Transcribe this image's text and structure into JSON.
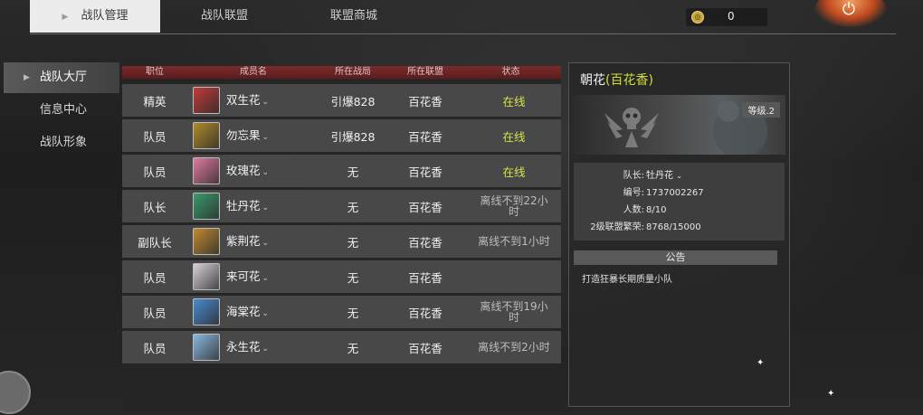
{
  "tabs": [
    {
      "label": "战队管理",
      "active": true
    },
    {
      "label": "战队联盟",
      "active": false
    },
    {
      "label": "联盟商城",
      "active": false
    }
  ],
  "currency": {
    "value": "0",
    "icon": "coin-icon"
  },
  "sidebar": {
    "items": [
      {
        "label": "战队大厅",
        "active": true
      },
      {
        "label": "信息中心",
        "active": false
      },
      {
        "label": "战队形象",
        "active": false
      }
    ]
  },
  "table": {
    "headers": [
      "职位",
      "成员名",
      "所在战局",
      "所在联盟",
      "状态"
    ],
    "rows": [
      {
        "position": "精英",
        "name": "双生花",
        "game": "引爆828",
        "alliance": "百花香",
        "status": "在线",
        "online": true,
        "avatar_color": "#c23a3a"
      },
      {
        "position": "队员",
        "name": "勿忘果",
        "game": "引爆828",
        "alliance": "百花香",
        "status": "在线",
        "online": true,
        "avatar_color": "#b08a2a"
      },
      {
        "position": "队员",
        "name": "玫瑰花",
        "game": "无",
        "alliance": "百花香",
        "status": "在线",
        "online": true,
        "avatar_color": "#e07aa0"
      },
      {
        "position": "队长",
        "name": "牡丹花",
        "game": "无",
        "alliance": "百花香",
        "status": "离线不到22小时",
        "online": false,
        "avatar_color": "#3a9a6a"
      },
      {
        "position": "副队长",
        "name": "紫荆花",
        "game": "无",
        "alliance": "百花香",
        "status": "离线不到1小时",
        "online": false,
        "avatar_color": "#c08a30"
      },
      {
        "position": "队员",
        "name": "来可花",
        "game": "无",
        "alliance": "百花香",
        "status": "",
        "online": false,
        "avatar_color": "#d8d0d8"
      },
      {
        "position": "队员",
        "name": "海棠花",
        "game": "无",
        "alliance": "百花香",
        "status": "离线不到19小时",
        "online": false,
        "avatar_color": "#4a8ad0"
      },
      {
        "position": "队员",
        "name": "永生花",
        "game": "无",
        "alliance": "百花香",
        "status": "离线不到2小时",
        "online": false,
        "avatar_color": "#8ab8e0"
      }
    ]
  },
  "team": {
    "name": "朝花",
    "alliance_tag": "(百花香)",
    "level": "等级.2",
    "info": [
      {
        "label": "队长:",
        "value": "牡丹花"
      },
      {
        "label": "编号:",
        "value": "1737002267"
      },
      {
        "label": "人数:",
        "value": "8/10"
      },
      {
        "label": "2级联盟繁荣:",
        "value": "8768/15000"
      }
    ],
    "notice_title": "公告",
    "notice_text": "打造狂暴长期质量小队"
  },
  "colors": {
    "accent_online": "#d8e24a",
    "header_red": "#6a2222",
    "alliance_tag": "#d4dc3c"
  }
}
